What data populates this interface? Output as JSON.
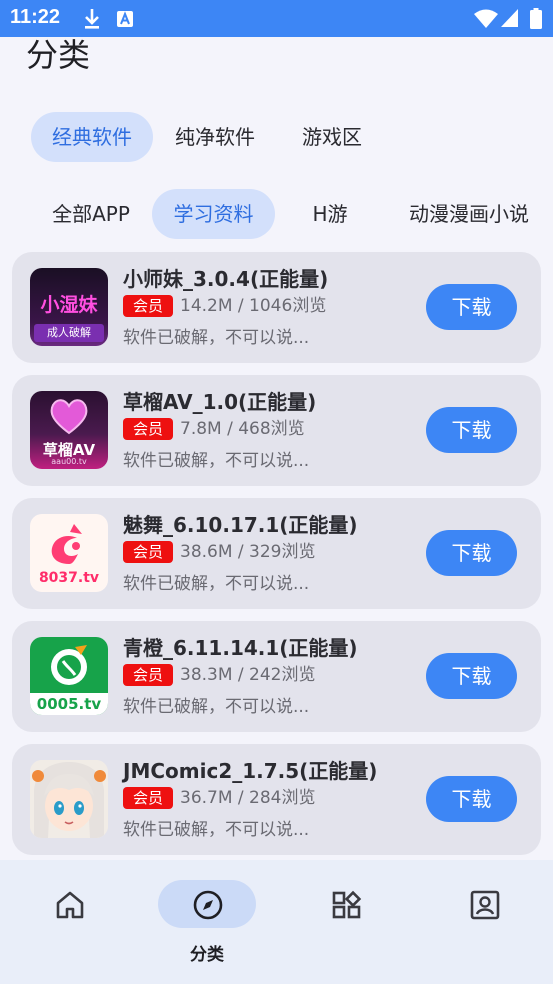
{
  "status_bar": {
    "time": "11:22"
  },
  "page_title": "分类",
  "tabs": [
    {
      "label": "经典软件",
      "active": true
    },
    {
      "label": "纯净软件",
      "active": false
    },
    {
      "label": "游戏区",
      "active": false
    }
  ],
  "subtabs": [
    {
      "label": "全部APP",
      "active": false
    },
    {
      "label": "学习资料",
      "active": true
    },
    {
      "label": "H游",
      "active": false
    },
    {
      "label": "动漫漫画小说",
      "active": false
    }
  ],
  "apps": [
    {
      "name": "小师妹_3.0.4(正能量)",
      "badge": "会员",
      "meta": "14.2M / 1046浏览",
      "desc": "软件已破解，不可以说...",
      "button": "下载",
      "icon_text": "小湿妹",
      "icon_sub": "成人破解"
    },
    {
      "name": "草榴AV_1.0(正能量)",
      "badge": "会员",
      "meta": "7.8M / 468浏览",
      "desc": "软件已破解，不可以说...",
      "button": "下载",
      "icon_text": "草榴AV",
      "icon_sub": "aau00.tv"
    },
    {
      "name": "魅舞_6.10.17.1(正能量)",
      "badge": "会员",
      "meta": "38.6M / 329浏览",
      "desc": "软件已破解，不可以说...",
      "button": "下载",
      "icon_text": "8037.tv"
    },
    {
      "name": "青橙_6.11.14.1(正能量)",
      "badge": "会员",
      "meta": "38.3M / 242浏览",
      "desc": "软件已破解，不可以说...",
      "button": "下载",
      "icon_text": "0005.tv"
    },
    {
      "name": "JMComic2_1.7.5(正能量)",
      "badge": "会员",
      "meta": "36.7M / 284浏览",
      "desc": "软件已破解，不可以说...",
      "button": "下载"
    }
  ],
  "bottom_nav": [
    {
      "icon": "home-icon",
      "label": ""
    },
    {
      "icon": "compass-icon",
      "label": "分类",
      "active": true
    },
    {
      "icon": "apps-grid-icon",
      "label": ""
    },
    {
      "icon": "profile-card-icon",
      "label": ""
    }
  ]
}
